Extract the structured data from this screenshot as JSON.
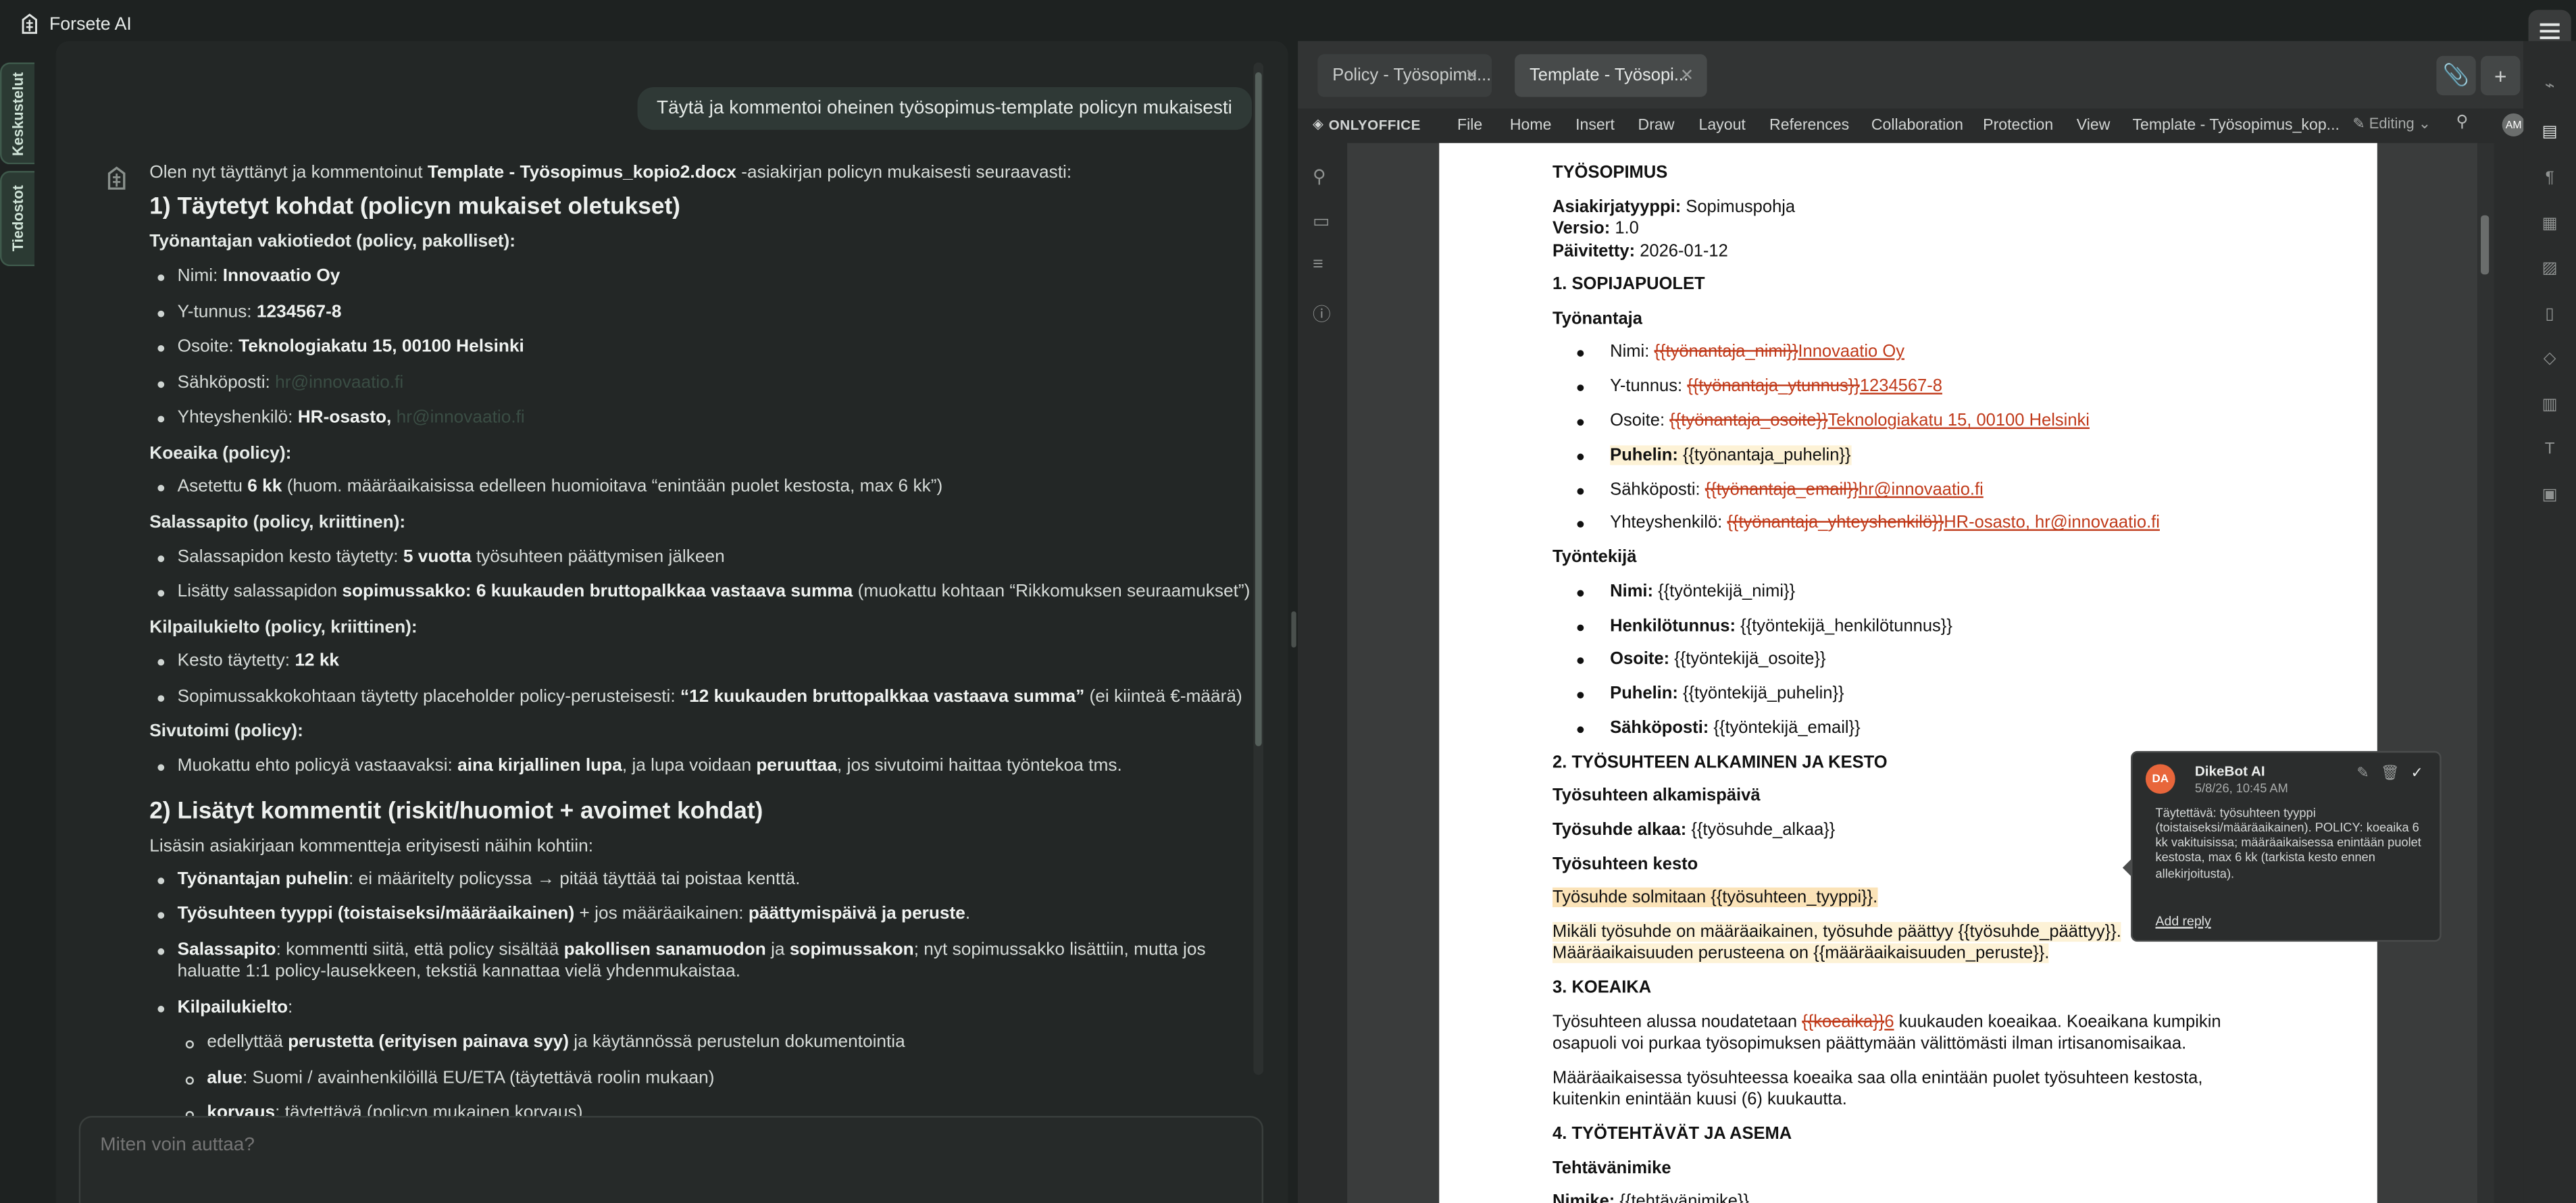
{
  "app": {
    "name": "Forsete AI"
  },
  "side_tabs": [
    "Keskustelut",
    "Tiedostot"
  ],
  "chat": {
    "user_message": "Täytä ja kommentoi oheinen työsopimus-template policyn mukaisesti",
    "intro_pre": "Olen nyt täyttänyt ja kommentoinut ",
    "intro_file": "Template - Työsopimus_kopio2.docx",
    "intro_post": " -asiakirjan policyn mukaisesti seuraavasti:",
    "section1_title": "1) Täytetyt kohdat (policyn mukaiset oletukset)",
    "employer_head": "Työnantajan vakiotiedot (policy, pakolliset):",
    "emp_name_label": "Nimi: ",
    "emp_name": "Innovaatio Oy",
    "emp_ytunnus_label": "Y-tunnus: ",
    "emp_ytunnus": "1234567-8",
    "emp_address_label": "Osoite: ",
    "emp_address": "Teknologiakatu 15, 00100 Helsinki",
    "emp_email_label": "Sähköposti: ",
    "emp_email": "hr@innovaatio.fi",
    "emp_contact_label": "Yhteyshenkilö: ",
    "emp_contact": "HR-osasto, ",
    "emp_contact_email": "hr@innovaatio.fi",
    "trial_head": "Koeaika (policy):",
    "trial_pre": "Asetettu ",
    "trial_val": "6 kk",
    "trial_post": " (huom. määräaikaisissa edelleen huomioitava “enintään puolet kestosta, max 6 kk”)",
    "conf_head": "Salassapito (policy, kriittinen):",
    "conf1_pre": "Salassapidon kesto täytetty: ",
    "conf1_val": "5 vuotta",
    "conf1_post": " työsuhteen päättymisen jälkeen",
    "conf2_pre": "Lisätty salassapidon ",
    "conf2_val": "sopimussakko: 6 kuukauden bruttopalkkaa vastaava summa",
    "conf2_post": " (muokattu kohtaan “Rikkomuksen seuraamukset”)",
    "comp_head": "Kilpailukielto (policy, kriittinen):",
    "comp1_pre": "Kesto täytetty: ",
    "comp1_val": "12 kk",
    "comp2_pre": "Sopimussakkokohtaan täytetty placeholder policy-perusteisesti: ",
    "comp2_val": "“12 kuukauden bruttopalkkaa vastaava summa”",
    "comp2_post": " (ei kiinteä €-määrä)",
    "side_head": "Sivutoimi (policy):",
    "side_pre": "Muokattu ehto policyä vastaavaksi: ",
    "side_val1": "aina kirjallinen lupa",
    "side_mid": ", ja lupa voidaan ",
    "side_val2": "peruuttaa",
    "side_post": ", jos sivutoimi haittaa työntekoa tms.",
    "section2_title": "2) Lisätyt kommentit (riskit/huomiot + avoimet kohdat)",
    "s2_intro": "Lisäsin asiakirjaan kommentteja erityisesti näihin kohtiin:",
    "c1_b": "Työnantajan puhelin",
    "c1_t": ": ei määritelty policyssa → pitää täyttää tai poistaa kenttä.",
    "c2_b": "Työsuhteen tyyppi (toistaiseksi/määräaikainen)",
    "c2_t": " + jos määräaikainen: ",
    "c2_b2": "päättymispäivä ja peruste",
    "c2_t2": ".",
    "c3_b": "Salassapito",
    "c3_t": ": kommentti siitä, että policy sisältää ",
    "c3_b2": "pakollisen sanamuodon",
    "c3_t2": " ja ",
    "c3_b3": "sopimussakon",
    "c3_t3": "; nyt sopimussakko lisättiin, mutta jos haluatte 1:1 policy-lausekkeen, tekstiä kannattaa vielä yhdenmukaistaa.",
    "c4_b": "Kilpailukielto",
    "c4_t": ":",
    "c4a_pre": "edellyttää ",
    "c4a_b": "perustetta (erityisen painava syy)",
    "c4a_post": " ja käytännössä perustelun dokumentointia",
    "c4b_b": "alue",
    "c4b_t": ": Suomi / avainhenkilöillä EU/ETA (täytettävä roolin mukaan)",
    "c4c_b": "korvaus",
    "c4c_t": ": täytettävä (policyn mukainen korvaus)",
    "composer_placeholder": "Miten voin auttaa?"
  },
  "editor": {
    "tabs": [
      {
        "label": "Policy - Työsopimu..."
      },
      {
        "label": "Template - Työsopi..."
      }
    ],
    "brand": "ONLYOFFICE",
    "menu": [
      "File",
      "Home",
      "Insert",
      "Draw",
      "Layout",
      "References",
      "Collaboration",
      "Protection",
      "View"
    ],
    "doc_title": "Template - Työsopimus_kop...",
    "mode": "Editing",
    "user_initials": "AM",
    "doc": {
      "title": "TYÖSOPIMUS",
      "type_label": "Asiakirjatyyppi:",
      "type": " Sopimuspohja",
      "version_label": "Versio:",
      "version": " 1.0",
      "updated_label": "Päivitetty:",
      "updated": " 2026-01-12",
      "h1": "1. SOPIJAPUOLET",
      "employer": "Työnantaja",
      "e_name_l": "Nimi: ",
      "e_name_del": "{{työnantaja_nimi}}",
      "e_name_ins": "Innovaatio Oy",
      "e_y_l": "Y-tunnus: ",
      "e_y_del": "{{työnantaja_ytunnus}}",
      "e_y_ins": "1234567-8",
      "e_addr_l": "Osoite: ",
      "e_addr_del": "{{työnantaja_osoite}}",
      "e_addr_ins": "Teknologiakatu 15, 00100 Helsinki",
      "e_phone_l": "Puhelin:",
      "e_phone": " {{työnantaja_puhelin}}",
      "e_mail_l": "Sähköposti: ",
      "e_mail_del": "{{työnantaja_email}}",
      "e_mail_ins": "hr@innovaatio.fi",
      "e_cont_l": "Yhteyshenkilö: ",
      "e_cont_del": "{{työnantaja_yhteyshenkilö}}",
      "e_cont_ins": "HR-osasto, hr@innovaatio.fi",
      "employee": "Työntekijä",
      "w_name_l": "Nimi:",
      "w_name": " {{työntekijä_nimi}}",
      "w_hetu_l": "Henkilötunnus:",
      "w_hetu": " {{työntekijä_henkilötunnus}}",
      "w_addr_l": "Osoite:",
      "w_addr": " {{työntekijä_osoite}}",
      "w_phone_l": "Puhelin:",
      "w_phone": " {{työntekijä_puhelin}}",
      "w_mail_l": "Sähköposti:",
      "w_mail": " {{työntekijä_email}}",
      "h2": "2. TYÖSUHTEEN ALKAMINEN JA KESTO",
      "start_head": "Työsuhteen alkamispäivä",
      "start_l": "Työsuhde alkaa:",
      "start": " {{työsuhde_alkaa}}",
      "dur_head": "Työsuhteen kesto",
      "dur_line": "Työsuhde solmitaan {{työsuhteen_tyyppi}}.",
      "fixed_1": "Mikäli työsuhde on määräaikainen, työsuhde päättyy {{työsuhde_päättyy}}.",
      "fixed_2": "Määräaikaisuuden perusteena on {{määräaikaisuuden_peruste}}.",
      "h3": "3. KOEAIKA",
      "trial_pre": "Työsuhteen alussa noudatetaan ",
      "trial_del": "{{koeaika}}",
      "trial_ins": "6",
      "trial_post": " kuukauden koeaikaa. Koeaikana kumpikin",
      "trial_2": "osapuoli voi purkaa työsopimuksen päättymään välittömästi ilman irtisanomisaikaa.",
      "trial_3": "Määräaikaisessa työsuhteessa koeaika saa olla enintään puolet työsuhteen kestosta,",
      "trial_4": "kuitenkin enintään kuusi (6) kuukautta.",
      "h4": "4. TYÖTEHTÄVÄT JA ASEMA",
      "task_head": "Tehtävänimike",
      "title_l": "Nimike:",
      "title_v": " {{tehtävänimike}}"
    },
    "comment": {
      "initials": "DA",
      "author": "DikeBot AI",
      "date": "5/8/26, 10:45 AM",
      "body": "Täytettävä: työsuhteen tyyppi (toistaiseksi/määräaikainen). POLICY: koeaika 6 kk vakituisissa; määräaikaisessa enintään puolet kestosta, max 6 kk (tarkista kesto ennen allekirjoitusta).",
      "reply": "Add reply"
    }
  },
  "colors": {
    "accent": "#e8663b",
    "change": "#c03a1a",
    "highlight": "#fbe3b8"
  }
}
